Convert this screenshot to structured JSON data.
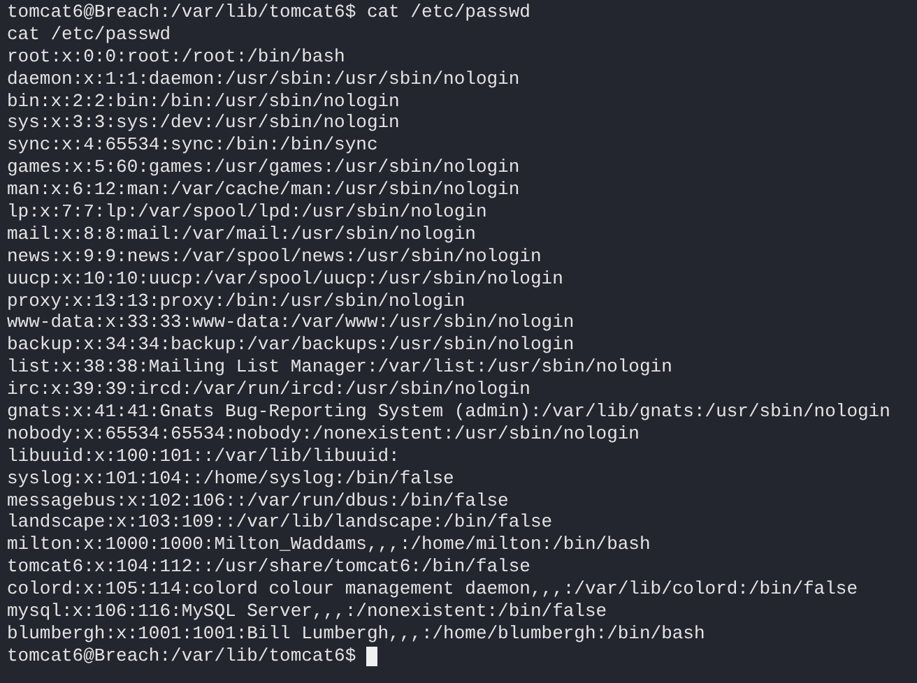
{
  "terminal": {
    "lines": [
      {
        "kind": "prompt",
        "prompt": "tomcat6@Breach:/var/lib/tomcat6$",
        "command": "cat /etc/passwd"
      },
      {
        "kind": "output",
        "text": "cat /etc/passwd"
      },
      {
        "kind": "output",
        "text": "root:x:0:0:root:/root:/bin/bash"
      },
      {
        "kind": "output",
        "text": "daemon:x:1:1:daemon:/usr/sbin:/usr/sbin/nologin"
      },
      {
        "kind": "output",
        "text": "bin:x:2:2:bin:/bin:/usr/sbin/nologin"
      },
      {
        "kind": "output",
        "text": "sys:x:3:3:sys:/dev:/usr/sbin/nologin"
      },
      {
        "kind": "output",
        "text": "sync:x:4:65534:sync:/bin:/bin/sync"
      },
      {
        "kind": "output",
        "text": "games:x:5:60:games:/usr/games:/usr/sbin/nologin"
      },
      {
        "kind": "output",
        "text": "man:x:6:12:man:/var/cache/man:/usr/sbin/nologin"
      },
      {
        "kind": "output",
        "text": "lp:x:7:7:lp:/var/spool/lpd:/usr/sbin/nologin"
      },
      {
        "kind": "output",
        "text": "mail:x:8:8:mail:/var/mail:/usr/sbin/nologin"
      },
      {
        "kind": "output",
        "text": "news:x:9:9:news:/var/spool/news:/usr/sbin/nologin"
      },
      {
        "kind": "output",
        "text": "uucp:x:10:10:uucp:/var/spool/uucp:/usr/sbin/nologin"
      },
      {
        "kind": "output",
        "text": "proxy:x:13:13:proxy:/bin:/usr/sbin/nologin"
      },
      {
        "kind": "output",
        "text": "www-data:x:33:33:www-data:/var/www:/usr/sbin/nologin"
      },
      {
        "kind": "output",
        "text": "backup:x:34:34:backup:/var/backups:/usr/sbin/nologin"
      },
      {
        "kind": "output",
        "text": "list:x:38:38:Mailing List Manager:/var/list:/usr/sbin/nologin"
      },
      {
        "kind": "output",
        "text": "irc:x:39:39:ircd:/var/run/ircd:/usr/sbin/nologin"
      },
      {
        "kind": "output",
        "text": "gnats:x:41:41:Gnats Bug-Reporting System (admin):/var/lib/gnats:/usr/sbin/nologin"
      },
      {
        "kind": "output",
        "text": "nobody:x:65534:65534:nobody:/nonexistent:/usr/sbin/nologin"
      },
      {
        "kind": "output",
        "text": "libuuid:x:100:101::/var/lib/libuuid:"
      },
      {
        "kind": "output",
        "text": "syslog:x:101:104::/home/syslog:/bin/false"
      },
      {
        "kind": "output",
        "text": "messagebus:x:102:106::/var/run/dbus:/bin/false"
      },
      {
        "kind": "output",
        "text": "landscape:x:103:109::/var/lib/landscape:/bin/false"
      },
      {
        "kind": "output",
        "text": "milton:x:1000:1000:Milton_Waddams,,,:/home/milton:/bin/bash"
      },
      {
        "kind": "output",
        "text": "tomcat6:x:104:112::/usr/share/tomcat6:/bin/false"
      },
      {
        "kind": "output",
        "text": "colord:x:105:114:colord colour management daemon,,,:/var/lib/colord:/bin/false"
      },
      {
        "kind": "output",
        "text": "mysql:x:106:116:MySQL Server,,,:/nonexistent:/bin/false"
      },
      {
        "kind": "output",
        "text": "blumbergh:x:1001:1001:Bill Lumbergh,,,:/home/blumbergh:/bin/bash"
      },
      {
        "kind": "cursor",
        "prompt": "tomcat6@Breach:/var/lib/tomcat6$"
      }
    ]
  }
}
